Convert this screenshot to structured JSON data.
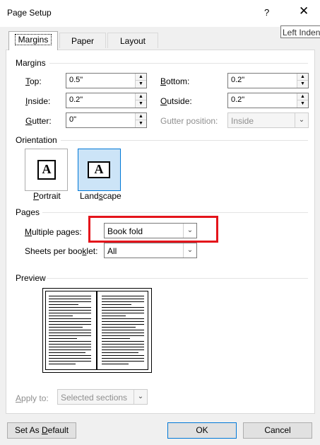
{
  "window": {
    "title": "Page Setup",
    "help": "?",
    "close": "✕"
  },
  "tooltip": "Left Indent",
  "tabs": [
    {
      "label": "Margins"
    },
    {
      "label": "Paper"
    },
    {
      "label": "Layout"
    }
  ],
  "margins": {
    "heading": "Margins",
    "top": {
      "label": "Top:",
      "value": "0.5\""
    },
    "bottom": {
      "label": "Bottom:",
      "value": "0.2\""
    },
    "inside": {
      "label": "Inside:",
      "value": "0.2\""
    },
    "outside": {
      "label": "Outside:",
      "value": "0.2\""
    },
    "gutter": {
      "label": "Gutter:",
      "value": "0\""
    },
    "gutter_position": {
      "label": "Gutter position:",
      "value": "Inside"
    }
  },
  "orientation": {
    "heading": "Orientation",
    "portrait": "Portrait",
    "landscape": "Landscape",
    "glyph": "A"
  },
  "pages": {
    "heading": "Pages",
    "multiple_pages_label": "Multiple pages:",
    "multiple_pages_value": "Book fold",
    "sheets_label": "Sheets per booklet:",
    "sheets_value": "All"
  },
  "preview": {
    "heading": "Preview"
  },
  "apply_to": {
    "label": "Apply to:",
    "value": "Selected sections"
  },
  "buttons": {
    "default": "Set As Default",
    "ok": "OK",
    "cancel": "Cancel"
  },
  "colors": {
    "highlight": "#e4141b",
    "accent": "#0078d7"
  }
}
